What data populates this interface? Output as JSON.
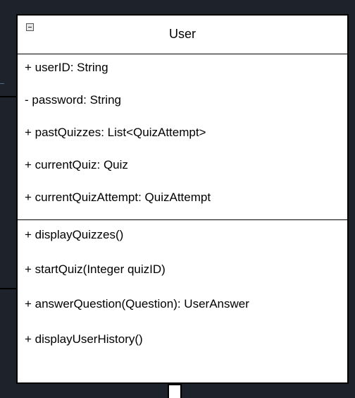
{
  "class_box": {
    "name": "User",
    "collapse_icon": "minus-square-icon"
  },
  "attributes": [
    "+ userID: String",
    "- password: String",
    "+ pastQuizzes: List<QuizAttempt>",
    "+ currentQuiz: Quiz",
    "+ currentQuizAttempt: QuizAttempt"
  ],
  "methods": [
    "+ displayQuizzes()",
    "+ startQuiz(Integer quizID)",
    "+ answerQuestion(Question): UserAnswer",
    "+ displayUserHistory()"
  ],
  "colors": {
    "background": "#1e232b",
    "box_fill": "#ffffff",
    "border": "#000000",
    "text": "#000000"
  }
}
